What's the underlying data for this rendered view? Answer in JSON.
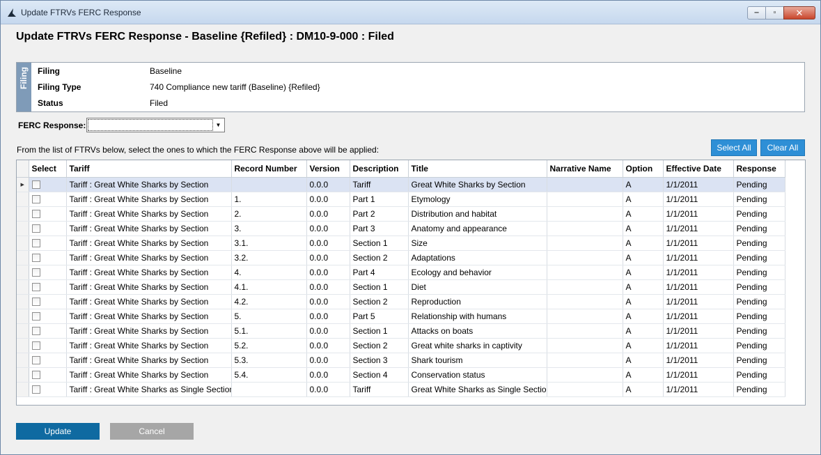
{
  "window": {
    "title": "Update FTRVs FERC Response",
    "controls": {
      "minimize": "‒",
      "maximize": "▫",
      "close": "✕"
    }
  },
  "page_title": "Update FTRVs FERC Response - Baseline {Refiled} : DM10-9-000 : Filed",
  "filing": {
    "section_label": "Filing",
    "rows": [
      {
        "key": "Filing",
        "value": "Baseline"
      },
      {
        "key": "Filing Type",
        "value": "740 Compliance new tariff (Baseline) {Refiled}"
      },
      {
        "key": "Status",
        "value": "Filed"
      }
    ]
  },
  "ferc_response": {
    "label": "FERC Response:",
    "value": "",
    "arrow": "▼"
  },
  "instructions": "From the list of FTRVs below, select the ones to which the FERC Response above will be applied:",
  "buttons": {
    "select_all": "Select All",
    "clear_all": "Clear All",
    "update": "Update",
    "cancel": "Cancel"
  },
  "grid": {
    "current_row_indicator": "▶",
    "columns": [
      "Select",
      "Tariff",
      "Record Number",
      "Version",
      "Description",
      "Title",
      "Narrative Name",
      "Option",
      "Effective Date",
      "Response"
    ],
    "rows": [
      {
        "tariff": "Tariff : Great White Sharks by Section",
        "record": "",
        "version": "0.0.0",
        "description": "Tariff",
        "title": "Great White Sharks by Section",
        "narrative": "",
        "option": "A",
        "effective": "1/1/2011",
        "response": "Pending"
      },
      {
        "tariff": "Tariff : Great White Sharks by Section",
        "record": "1.",
        "version": "0.0.0",
        "description": "Part 1",
        "title": "Etymology",
        "narrative": "",
        "option": "A",
        "effective": "1/1/2011",
        "response": "Pending"
      },
      {
        "tariff": "Tariff : Great White Sharks by Section",
        "record": "2.",
        "version": "0.0.0",
        "description": "Part 2",
        "title": "Distribution and habitat",
        "narrative": "",
        "option": "A",
        "effective": "1/1/2011",
        "response": "Pending"
      },
      {
        "tariff": "Tariff : Great White Sharks by Section",
        "record": "3.",
        "version": "0.0.0",
        "description": "Part 3",
        "title": "Anatomy and appearance",
        "narrative": "",
        "option": "A",
        "effective": "1/1/2011",
        "response": "Pending"
      },
      {
        "tariff": "Tariff : Great White Sharks by Section",
        "record": "3.1.",
        "version": "0.0.0",
        "description": "Section 1",
        "title": "Size",
        "narrative": "",
        "option": "A",
        "effective": "1/1/2011",
        "response": "Pending"
      },
      {
        "tariff": "Tariff : Great White Sharks by Section",
        "record": "3.2.",
        "version": "0.0.0",
        "description": "Section 2",
        "title": "Adaptations",
        "narrative": "",
        "option": "A",
        "effective": "1/1/2011",
        "response": "Pending"
      },
      {
        "tariff": "Tariff : Great White Sharks by Section",
        "record": "4.",
        "version": "0.0.0",
        "description": "Part 4",
        "title": "Ecology and behavior",
        "narrative": "",
        "option": "A",
        "effective": "1/1/2011",
        "response": "Pending"
      },
      {
        "tariff": "Tariff : Great White Sharks by Section",
        "record": "4.1.",
        "version": "0.0.0",
        "description": "Section 1",
        "title": "Diet",
        "narrative": "",
        "option": "A",
        "effective": "1/1/2011",
        "response": "Pending"
      },
      {
        "tariff": "Tariff : Great White Sharks by Section",
        "record": "4.2.",
        "version": "0.0.0",
        "description": "Section 2",
        "title": "Reproduction",
        "narrative": "",
        "option": "A",
        "effective": "1/1/2011",
        "response": "Pending"
      },
      {
        "tariff": "Tariff : Great White Sharks by Section",
        "record": "5.",
        "version": "0.0.0",
        "description": "Part 5",
        "title": "Relationship with humans",
        "narrative": "",
        "option": "A",
        "effective": "1/1/2011",
        "response": "Pending"
      },
      {
        "tariff": "Tariff : Great White Sharks by Section",
        "record": "5.1.",
        "version": "0.0.0",
        "description": "Section 1",
        "title": "Attacks on boats",
        "narrative": "",
        "option": "A",
        "effective": "1/1/2011",
        "response": "Pending"
      },
      {
        "tariff": "Tariff : Great White Sharks by Section",
        "record": "5.2.",
        "version": "0.0.0",
        "description": "Section 2",
        "title": "Great white sharks in captivity",
        "narrative": "",
        "option": "A",
        "effective": "1/1/2011",
        "response": "Pending"
      },
      {
        "tariff": "Tariff : Great White Sharks by Section",
        "record": "5.3.",
        "version": "0.0.0",
        "description": "Section 3",
        "title": "Shark tourism",
        "narrative": "",
        "option": "A",
        "effective": "1/1/2011",
        "response": "Pending"
      },
      {
        "tariff": "Tariff : Great White Sharks by Section",
        "record": "5.4.",
        "version": "0.0.0",
        "description": "Section 4",
        "title": "Conservation status",
        "narrative": "",
        "option": "A",
        "effective": "1/1/2011",
        "response": "Pending"
      },
      {
        "tariff": "Tariff : Great White Sharks as Single Section",
        "record": "",
        "version": "0.0.0",
        "description": "Tariff",
        "title": "Great White Sharks as Single Section",
        "narrative": "",
        "option": "A",
        "effective": "1/1/2011",
        "response": "Pending"
      }
    ]
  }
}
